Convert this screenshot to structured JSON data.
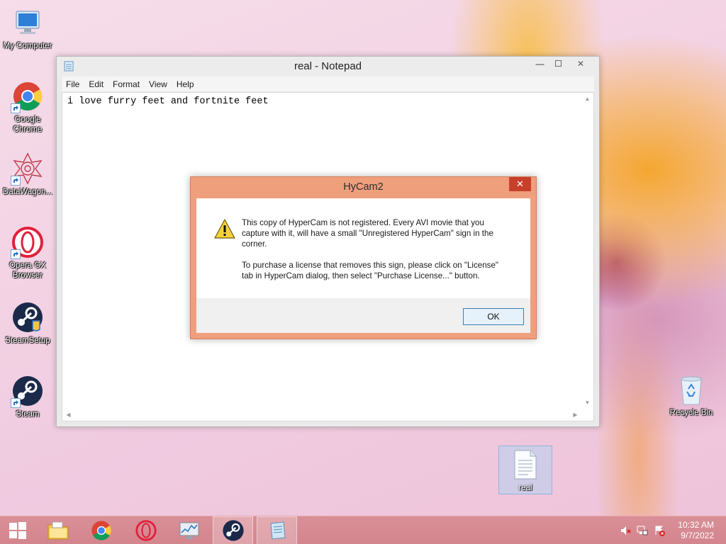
{
  "desktop": {
    "icons": [
      {
        "label": "My Computer"
      },
      {
        "label": "Google Chrome"
      },
      {
        "label": "DataWagon..."
      },
      {
        "label": "Opera GX Browser"
      },
      {
        "label": "SteamSetup"
      },
      {
        "label": "Steam"
      },
      {
        "label": "Recycle Bin"
      },
      {
        "label": "real"
      }
    ]
  },
  "notepad": {
    "title": "real - Notepad",
    "menu": [
      "File",
      "Edit",
      "Format",
      "View",
      "Help"
    ],
    "content": "i love furry feet and fortnite feet",
    "controls": {
      "minimize": "—",
      "maximize": "☐",
      "close": "✕"
    }
  },
  "dialog": {
    "title": "HyCam2",
    "close": "✕",
    "message_1": "This copy of HyperCam is not registered. Every AVI movie that you capture with it, will have a small \"Unregistered HyperCam\" sign in the corner.",
    "message_2": "To purchase a license that removes this sign, please click on \"License\" tab in HyperCam dialog, then select \"Purchase License...\" button.",
    "ok_label": "OK"
  },
  "taskbar": {
    "time": "10:32 AM",
    "date": "9/7/2022",
    "pinned": [
      "start",
      "file-explorer",
      "chrome",
      "opera-gx",
      "performance-monitor",
      "steam",
      "notepad"
    ]
  },
  "colors": {
    "dialog_frame": "#ef9f7c",
    "dialog_close": "#c7402b",
    "taskbar": "#d4858e"
  }
}
